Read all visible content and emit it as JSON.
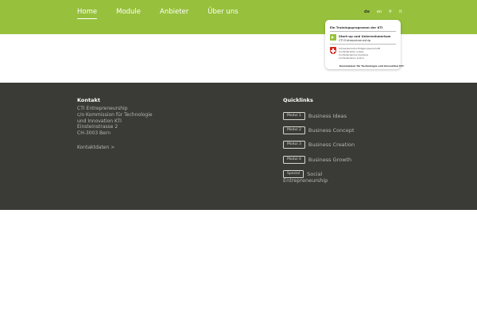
{
  "nav": {
    "items": [
      {
        "label": "Home"
      },
      {
        "label": "Module"
      },
      {
        "label": "Anbieter"
      },
      {
        "label": "Über uns"
      }
    ],
    "active_index": 0
  },
  "languages": {
    "items": [
      "de",
      "en",
      "fr",
      "it"
    ],
    "active": "de"
  },
  "kti_box": {
    "title": "Ein Trainingsprogramm der KTI",
    "program_line1": "Start-up und Unternehmertum",
    "program_line2": "CTI Entrepreneurship",
    "federation_lines": [
      "Schweizerische Eidgenossenschaft",
      "Confédération suisse",
      "Confederazione Svizzera",
      "Confederaziun svizra"
    ],
    "commission": "Kommission für Technologie und Innovation KTI"
  },
  "footer": {
    "contact": {
      "heading": "Kontakt",
      "address_lines": [
        "CTI Entrepreneurship",
        "c/o Kommission für Technologie",
        "und Innovation KTI",
        "Einsteinstrasse 2",
        "CH-3003 Bern"
      ],
      "link": "Kontaktdaten >"
    },
    "quicklinks": {
      "heading": "Quicklinks",
      "items": [
        {
          "badge": "Modul 1",
          "label": "Business Ideas"
        },
        {
          "badge": "Modul 2",
          "label": "Business Concept"
        },
        {
          "badge": "Modul 3",
          "label": "Business Creation"
        },
        {
          "badge": "Modul 4",
          "label": "Business Growth"
        },
        {
          "badge": "Spezial",
          "label": "Social",
          "label_cont": "Entrepreneurship"
        }
      ]
    }
  },
  "colors": {
    "brand_green": "#97c13c",
    "footer_bg": "#3a3a36",
    "footer_text": "#b8b8b0"
  }
}
